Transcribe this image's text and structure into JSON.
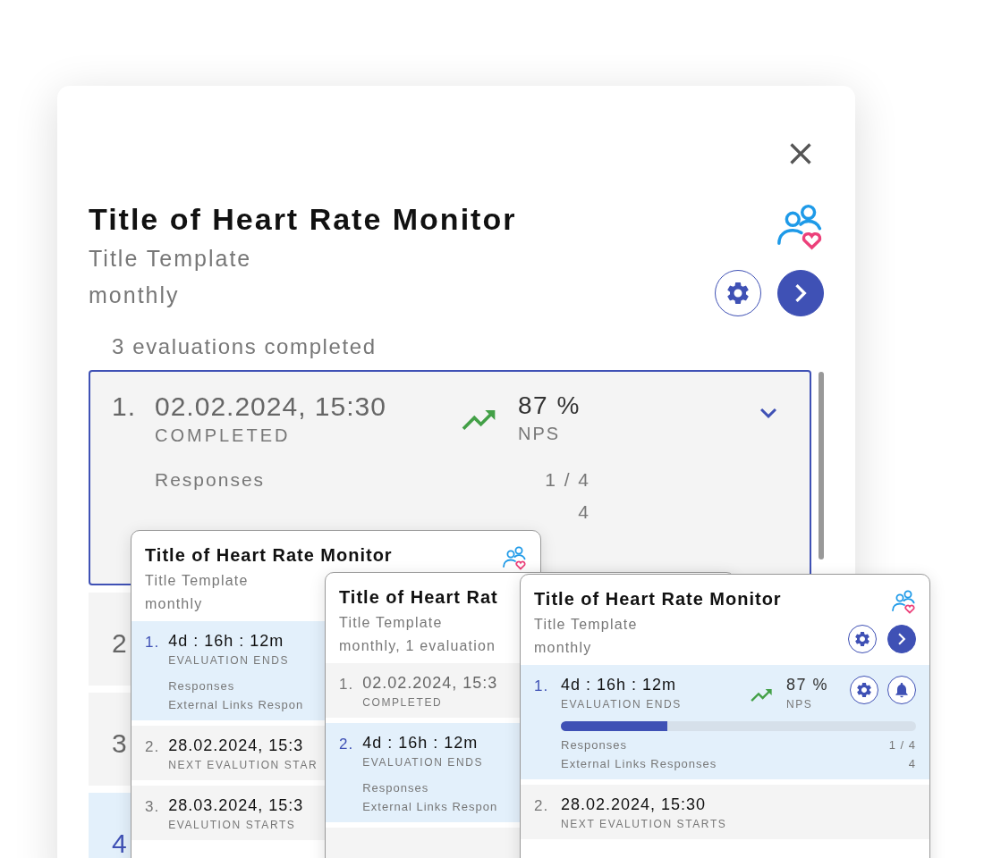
{
  "main_card": {
    "title": "Title of Heart Rate Monitor",
    "subtitle": "Title Template",
    "frequency": "monthly",
    "summary": "3 evaluations completed",
    "rows": [
      {
        "number": "1.",
        "date": "02.02.2024, 15:30",
        "status": "COMPLETED",
        "nps": {
          "value": "87 %",
          "label": "NPS"
        },
        "metrics": [
          {
            "label": "Responses",
            "value": "1 / 4"
          },
          {
            "value": "4"
          }
        ],
        "expanded": true,
        "active": false
      },
      {
        "number": "2",
        "expanded": false,
        "active": false
      },
      {
        "number": "3",
        "expanded": false,
        "active": false
      },
      {
        "number": "4",
        "expanded": false,
        "active": true
      }
    ]
  },
  "preview_cards": [
    {
      "title": "Title of Heart Rate Monitor",
      "subtitle": "Title Template",
      "frequency": "monthly",
      "rows": [
        {
          "number": "1.",
          "primary": "4d : 16h : 12m",
          "status": "EVALUATION ENDS",
          "active": true,
          "metrics": [
            {
              "label": "Responses"
            },
            {
              "label": "External Links Respon"
            }
          ]
        },
        {
          "number": "2.",
          "primary": "28.02.2024, 15:3",
          "status": "NEXT EVALUTION STAR",
          "active": false
        },
        {
          "number": "3.",
          "primary": "28.03.2024, 15:3",
          "status": "EVALUTION STARTS",
          "active": false
        }
      ]
    },
    {
      "title": "Title of Heart Rat",
      "subtitle": "Title Template",
      "frequency": "monthly, 1 evaluation",
      "rows": [
        {
          "number": "1.",
          "primary": "02.02.2024, 15:3",
          "status": "COMPLETED",
          "active": false,
          "muted": true
        },
        {
          "number": "2.",
          "primary": "4d : 16h : 12m",
          "status": "EVALUATION ENDS",
          "active": true,
          "metrics": [
            {
              "label": "Responses"
            },
            {
              "label": "External Links Respon"
            }
          ]
        },
        {
          "active": false
        }
      ]
    },
    {
      "title": "Title of Heart Rate Monitor",
      "subtitle": "Title Template",
      "frequency": "monthly",
      "header_actions": true,
      "rows": [
        {
          "number": "1.",
          "primary": "4d : 16h : 12m",
          "status": "EVALUATION ENDS",
          "active": true,
          "nps": {
            "value": "87 %",
            "label": "NPS"
          },
          "row_actions": true,
          "level": 0.3,
          "metrics": [
            {
              "label": "Responses",
              "value": "1 / 4"
            },
            {
              "label": "External Links Responses",
              "value": "4"
            }
          ]
        },
        {
          "number": "2.",
          "primary": "28.02.2024, 15:30",
          "status": "NEXT EVALUTION STARTS",
          "active": false
        }
      ]
    }
  ]
}
